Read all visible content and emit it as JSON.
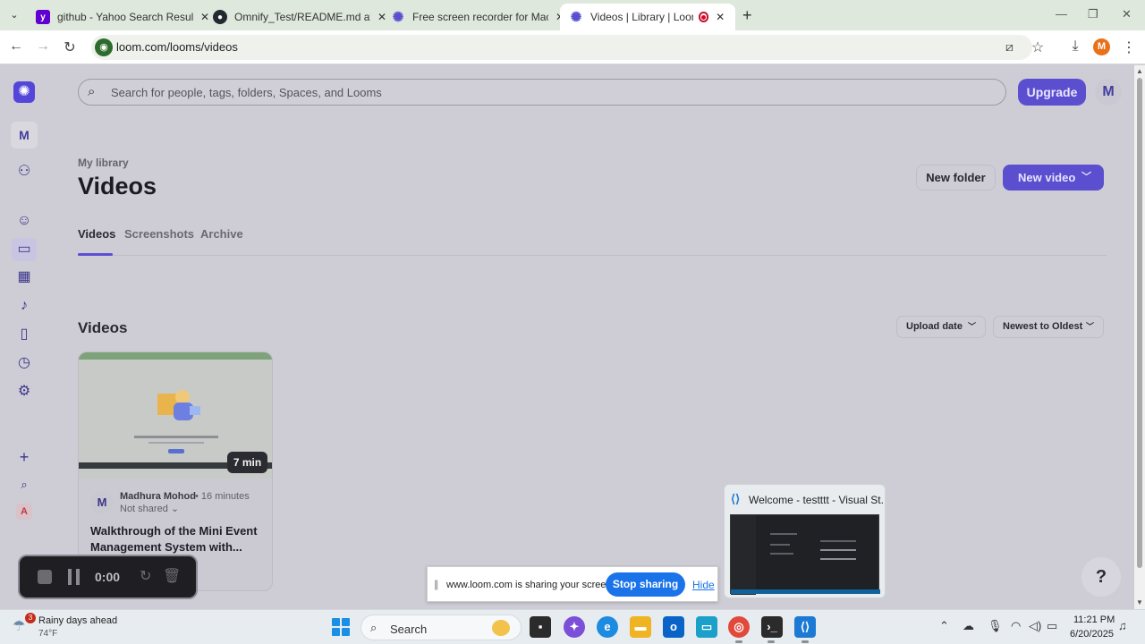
{
  "browser": {
    "tabs": [
      {
        "title": "github - Yahoo Search Results",
        "favicon": "yahoo-favicon"
      },
      {
        "title": "Omnify_Test/README.md at m",
        "favicon": "github-favicon"
      },
      {
        "title": "Free screen recorder for Mac an",
        "favicon": "loom-favicon"
      },
      {
        "title": "Videos | Library | Loom",
        "favicon": "loom-favicon"
      }
    ],
    "url": "loom.com/looms/videos",
    "profile_initial": "M"
  },
  "app": {
    "workspace_initial": "M",
    "search_placeholder": "Search for people, tags, folders, Spaces, and Looms",
    "upgrade_label": "Upgrade",
    "user_initial": "M",
    "breadcrumb": "My library",
    "page_title": "Videos",
    "new_folder_label": "New folder",
    "new_video_label": "New video",
    "tabs": [
      "Videos",
      "Screenshots",
      "Archive"
    ],
    "active_tab": "Videos",
    "section_title": "Videos",
    "sort_field_label": "Upload date",
    "sort_order_label": "Newest to Oldest",
    "workspace_badge": "A",
    "help_label": "?",
    "accent_color": "#5b4fcf"
  },
  "video_card": {
    "duration": "7 min",
    "owner_initial": "M",
    "owner": "Madhura Mohod",
    "time": "16 minutes",
    "share_status": "Not shared",
    "title": "Walkthrough of the Mini Event Management System with..."
  },
  "recorder": {
    "elapsed": "0:00"
  },
  "share_bar": {
    "message": "www.loom.com is sharing your screen.",
    "stop_label": "Stop sharing",
    "hide_label": "Hide"
  },
  "taskbar_preview": {
    "title": "Welcome - testttt - Visual St..."
  },
  "taskbar": {
    "weather_badge": "3",
    "weather_title": "Rainy days ahead",
    "weather_temp": "74°F",
    "search_label": "Search",
    "time": "11:21 PM",
    "date": "6/20/2025"
  }
}
